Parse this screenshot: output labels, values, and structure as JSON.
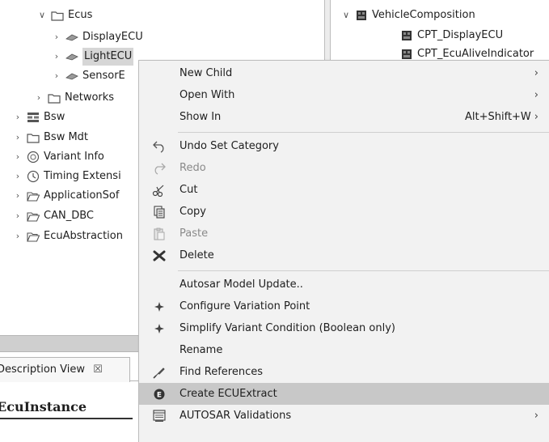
{
  "left_tree": {
    "items": [
      {
        "label": "Ecus",
        "icon": "folder-icon",
        "chevron": "down"
      },
      {
        "label": "DisplayECU",
        "icon": "ecu-icon",
        "chevron": "right"
      },
      {
        "label": "LightECU",
        "icon": "ecu-icon",
        "chevron": "right"
      },
      {
        "label": "SensorE",
        "icon": "ecu-icon",
        "chevron": "right"
      },
      {
        "label": "Networks",
        "icon": "folder-icon",
        "chevron": "right"
      },
      {
        "label": "Bsw",
        "icon": "bsw-icon",
        "chevron": "right"
      },
      {
        "label": "Bsw Mdt",
        "icon": "folder-icon",
        "chevron": "right"
      },
      {
        "label": "Variant Info",
        "icon": "variant-icon",
        "chevron": "right"
      },
      {
        "label": "Timing Extensi",
        "icon": "clock-icon",
        "chevron": "right"
      },
      {
        "label": "ApplicationSof",
        "icon": "open-folder-icon",
        "chevron": "right"
      },
      {
        "label": "CAN_DBC",
        "icon": "open-folder-icon",
        "chevron": "right"
      },
      {
        "label": "EcuAbstraction",
        "icon": "open-folder-icon",
        "chevron": "right"
      }
    ]
  },
  "right_tree": {
    "items": [
      {
        "label": "VehicleComposition",
        "icon": "composition-icon",
        "chevron": "down"
      },
      {
        "label": "CPT_DisplayECU",
        "icon": "composition-icon"
      },
      {
        "label": "CPT_EcuAliveIndicator",
        "icon": "composition-icon"
      }
    ]
  },
  "description_view": {
    "tab_label": "Description View",
    "close_glyph": "☒",
    "title": "EcuInstance"
  },
  "context_menu": {
    "items": [
      {
        "label": "New Child",
        "icon": "",
        "shortcut": "",
        "submenu": true,
        "disabled": false,
        "highlighted": false
      },
      {
        "label": "Open With",
        "icon": "",
        "shortcut": "",
        "submenu": true,
        "disabled": false,
        "highlighted": false
      },
      {
        "label": "Show In",
        "icon": "",
        "shortcut": "Alt+Shift+W",
        "submenu": true,
        "disabled": false,
        "highlighted": false
      },
      {
        "label": "Undo Set Category",
        "icon": "undo-icon",
        "shortcut": "",
        "submenu": false,
        "disabled": false,
        "highlighted": false
      },
      {
        "label": "Redo",
        "icon": "redo-icon",
        "shortcut": "",
        "submenu": false,
        "disabled": true,
        "highlighted": false
      },
      {
        "label": "Cut",
        "icon": "scissors-icon",
        "shortcut": "",
        "submenu": false,
        "disabled": false,
        "highlighted": false
      },
      {
        "label": "Copy",
        "icon": "copy-icon",
        "shortcut": "",
        "submenu": false,
        "disabled": false,
        "highlighted": false
      },
      {
        "label": "Paste",
        "icon": "paste-icon",
        "shortcut": "",
        "submenu": false,
        "disabled": true,
        "highlighted": false
      },
      {
        "label": "Delete",
        "icon": "delete-icon",
        "shortcut": "",
        "submenu": false,
        "disabled": false,
        "highlighted": false
      },
      {
        "label": "Autosar Model Update..",
        "icon": "",
        "shortcut": "",
        "submenu": false,
        "disabled": false,
        "highlighted": false
      },
      {
        "label": "Configure Variation Point",
        "icon": "variation-point-icon",
        "shortcut": "",
        "submenu": false,
        "disabled": false,
        "highlighted": false
      },
      {
        "label": "Simplify Variant Condition (Boolean only)",
        "icon": "variation-point-icon",
        "shortcut": "",
        "submenu": false,
        "disabled": false,
        "highlighted": false
      },
      {
        "label": "Rename",
        "icon": "",
        "shortcut": "",
        "submenu": false,
        "disabled": false,
        "highlighted": false
      },
      {
        "label": "Find References",
        "icon": "find-references-icon",
        "shortcut": "",
        "submenu": false,
        "disabled": false,
        "highlighted": false
      },
      {
        "label": "Create ECUExtract",
        "icon": "extract-icon",
        "shortcut": "",
        "submenu": false,
        "disabled": false,
        "highlighted": true
      },
      {
        "label": "AUTOSAR Validations",
        "icon": "validation-icon",
        "shortcut": "",
        "submenu": true,
        "disabled": false,
        "highlighted": false
      }
    ]
  },
  "colors": {
    "menu_background": "#f2f2f2",
    "highlight": "#c8c8c8",
    "selection": "#d6d6d6",
    "disabled_text": "#8a8a8a"
  }
}
